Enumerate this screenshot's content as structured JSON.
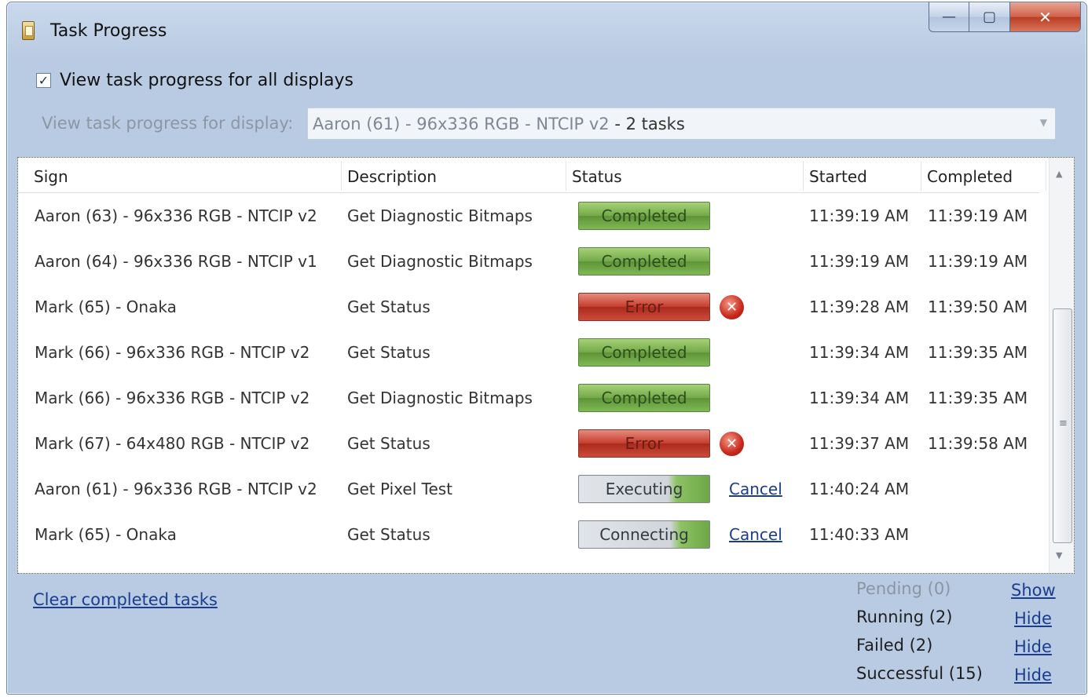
{
  "window": {
    "title": "Task Progress",
    "app_icon": "scroll-icon"
  },
  "caption": {
    "minimize": "—",
    "maximize": "▢",
    "close": "✕"
  },
  "options": {
    "view_all_label": "View task progress for all displays",
    "view_all_checked": true,
    "check_glyph": "✓",
    "display_label": "View task progress for display:",
    "display_value": "Aaron (61) - 96x336 RGB - NTCIP v2",
    "display_tasks": " - 2 tasks",
    "dropdown_arrow": "▼"
  },
  "table": {
    "headers": {
      "sign": "Sign",
      "description": "Description",
      "status": "Status",
      "started": "Started",
      "completed": "Completed"
    },
    "rows": [
      {
        "sign": "Aaron (63) - 96x336 RGB - NTCIP v2",
        "description": "Get Diagnostic Bitmaps",
        "status": "Completed",
        "started": "11:39:19 AM",
        "completed": "11:39:19 AM"
      },
      {
        "sign": "Aaron (64) - 96x336 RGB - NTCIP v1",
        "description": "Get Diagnostic Bitmaps",
        "status": "Completed",
        "started": "11:39:19 AM",
        "completed": "11:39:19 AM"
      },
      {
        "sign": "Mark (65) - Onaka",
        "description": "Get Status",
        "status": "Error",
        "started": "11:39:28 AM",
        "completed": "11:39:50 AM"
      },
      {
        "sign": "Mark (66) - 96x336 RGB - NTCIP v2",
        "description": "Get Status",
        "status": "Completed",
        "started": "11:39:34 AM",
        "completed": "11:39:35 AM"
      },
      {
        "sign": "Mark (66) - 96x336 RGB - NTCIP v2",
        "description": "Get Diagnostic Bitmaps",
        "status": "Completed",
        "started": "11:39:34 AM",
        "completed": "11:39:35 AM"
      },
      {
        "sign": "Mark (67) - 64x480 RGB - NTCIP v2",
        "description": "Get Status",
        "status": "Error",
        "started": "11:39:37 AM",
        "completed": "11:39:58 AM"
      },
      {
        "sign": "Aaron (61) - 96x336 RGB - NTCIP v2",
        "description": "Get Pixel Test",
        "status": "Executing",
        "action": "Cancel",
        "started": "11:40:24 AM",
        "completed": ""
      },
      {
        "sign": "Mark (65) - Onaka",
        "description": "Get Status",
        "status": "Connecting",
        "action": "Cancel",
        "started": "11:40:33 AM",
        "completed": ""
      }
    ],
    "error_glyph": "✕",
    "scroll": {
      "up": "▲",
      "down": "▼",
      "grip": "≡"
    }
  },
  "footer": {
    "clear_link": "Clear completed tasks",
    "summary": [
      {
        "label": "Pending (0)",
        "action": "Show"
      },
      {
        "label": "Running (2)",
        "action": "Hide"
      },
      {
        "label": "Failed (2)",
        "action": "Hide"
      },
      {
        "label": "Successful (15)",
        "action": "Hide"
      }
    ]
  }
}
